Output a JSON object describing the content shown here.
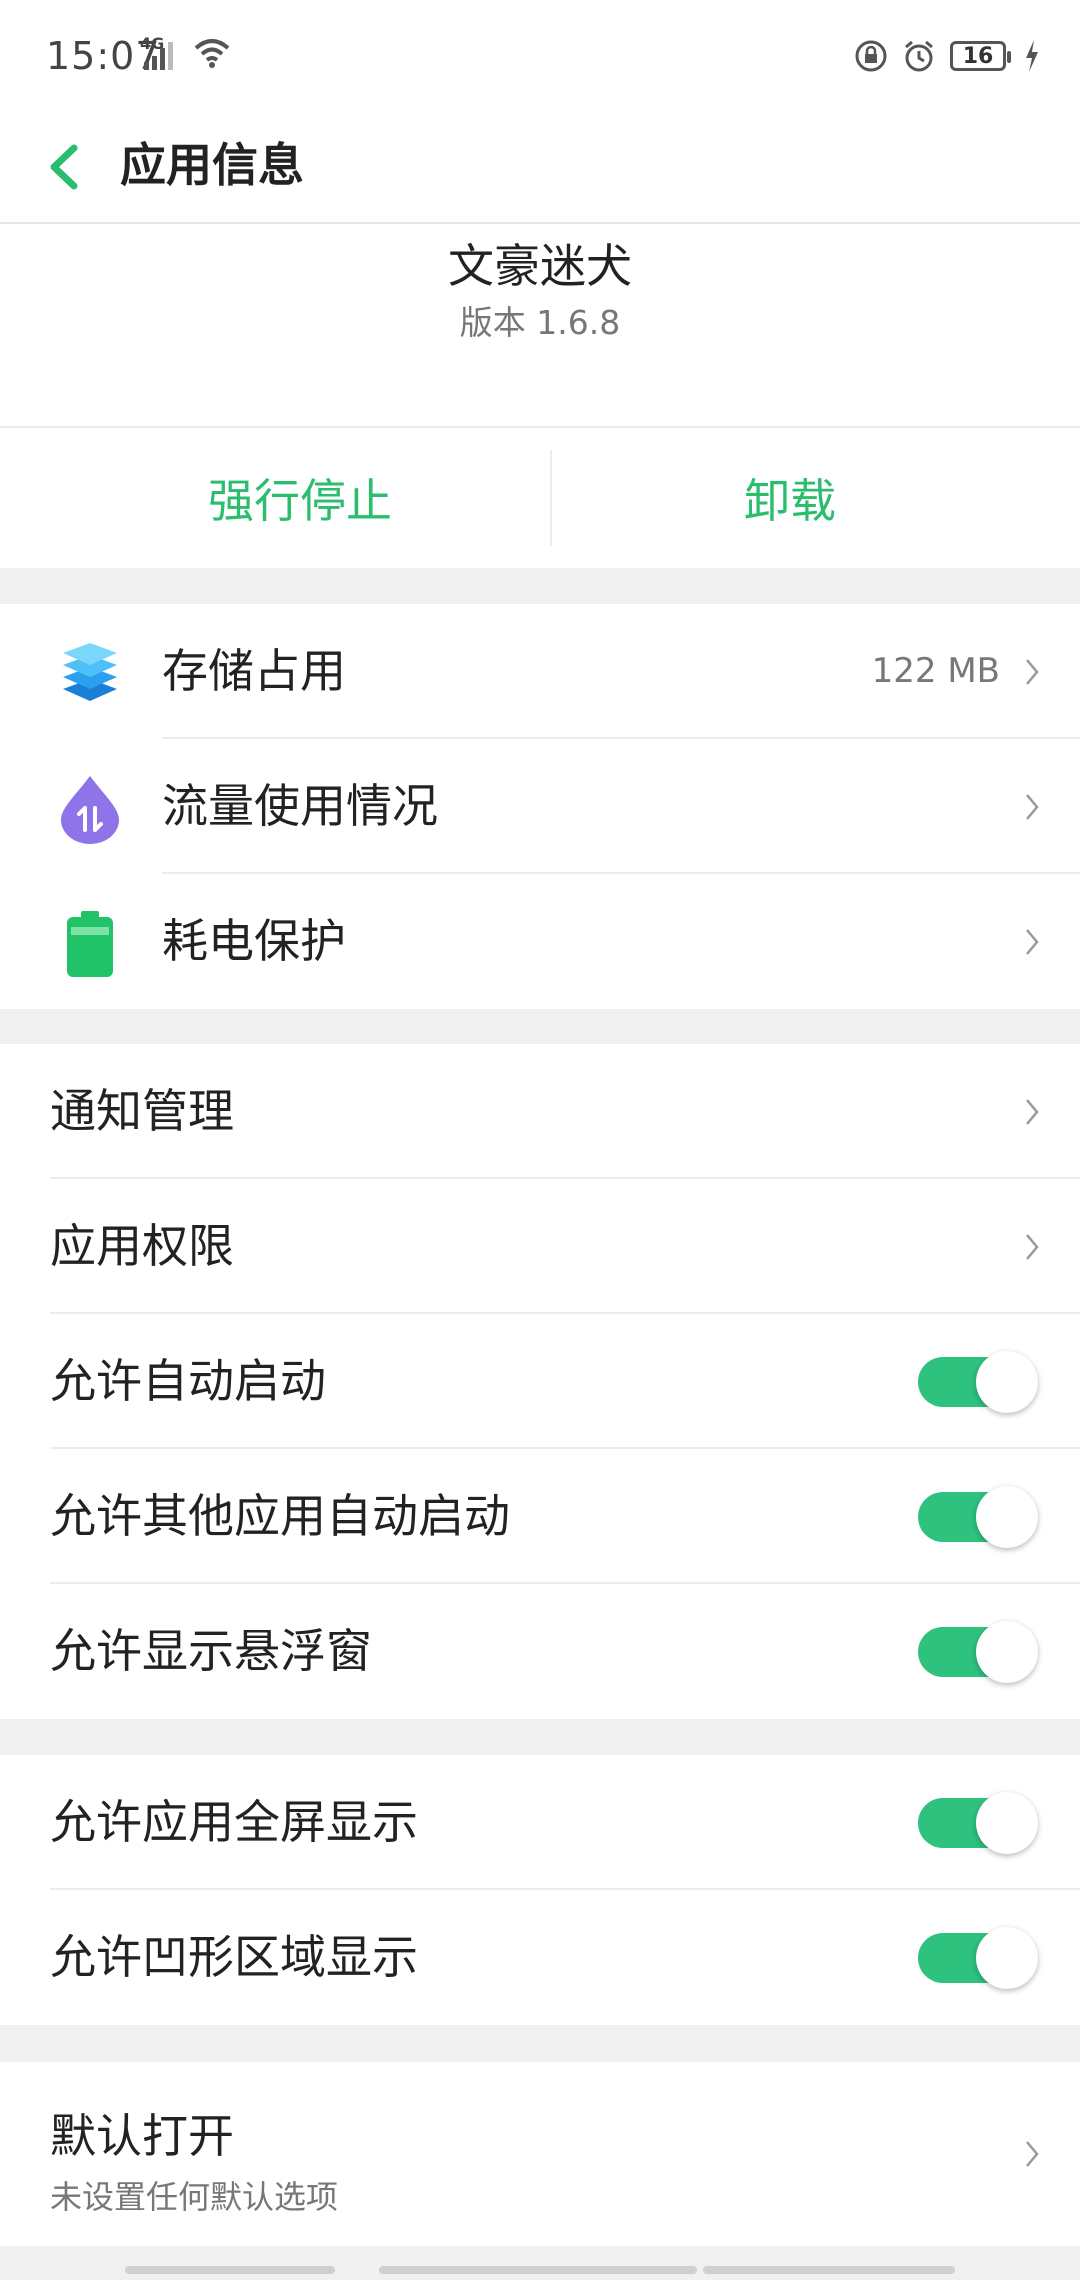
{
  "status_bar": {
    "time": "15:07",
    "network_type": "4G",
    "battery_level": "16",
    "icons": [
      "signal-icon",
      "wifi-icon",
      "lock-icon",
      "alarm-icon",
      "battery-icon",
      "charging-icon"
    ]
  },
  "app_bar": {
    "back_icon": "chevron-left-icon",
    "title": "应用信息"
  },
  "app_info": {
    "name": "文豪迷犬",
    "version": "版本 1.6.8"
  },
  "actions": {
    "force_stop": "强行停止",
    "uninstall": "卸载"
  },
  "usage_section": {
    "items": [
      {
        "icon": "storage-layers-icon",
        "label": "存储占用",
        "value": "122 MB"
      },
      {
        "icon": "data-usage-icon",
        "label": "流量使用情况",
        "value": ""
      },
      {
        "icon": "battery-protect-icon",
        "label": "耗电保护",
        "value": ""
      }
    ]
  },
  "settings_section": {
    "items": [
      {
        "label": "通知管理",
        "type": "link"
      },
      {
        "label": "应用权限",
        "type": "link"
      },
      {
        "label": "允许自动启动",
        "type": "toggle",
        "on": true
      },
      {
        "label": "允许其他应用自动启动",
        "type": "toggle",
        "on": true
      },
      {
        "label": "允许显示悬浮窗",
        "type": "toggle",
        "on": true
      }
    ]
  },
  "display_section": {
    "items": [
      {
        "label": "允许应用全屏显示",
        "type": "toggle",
        "on": true
      },
      {
        "label": "允许凹形区域显示",
        "type": "toggle",
        "on": true
      }
    ]
  },
  "default_open": {
    "title": "默认打开",
    "subtitle": "未设置任何默认选项"
  },
  "colors": {
    "accent": "#2bbd6e",
    "toggle_on": "#2ec27e",
    "divider": "#ececec",
    "background": "#f0f0f0"
  }
}
